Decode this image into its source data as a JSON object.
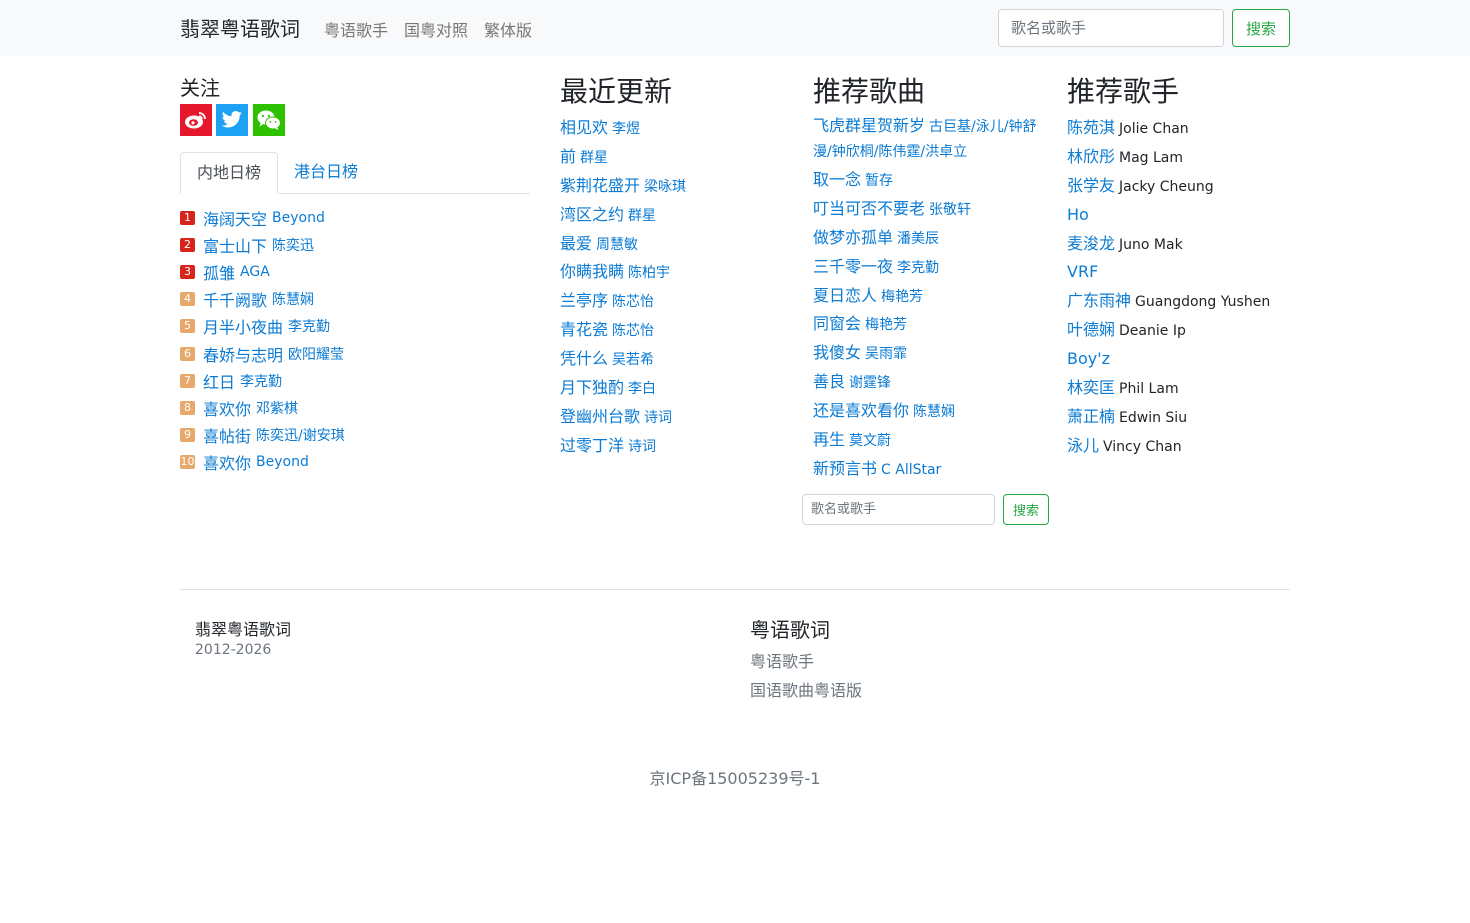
{
  "navbar": {
    "brand": "翡翠粤语歌词",
    "links": [
      "粤语歌手",
      "国粤对照",
      "繁体版"
    ],
    "search_placeholder": "歌名或歌手",
    "search_button": "搜索"
  },
  "follow": {
    "title": "关注",
    "icons": [
      "weibo-icon",
      "twitter-icon",
      "wechat-icon"
    ],
    "colors": {
      "weibo": "#e6162d",
      "twitter": "#1da1f2",
      "wechat": "#2dc100"
    }
  },
  "ranking": {
    "tabs": [
      "内地日榜",
      "港台日榜"
    ],
    "active_tab": "内地日榜",
    "items": [
      {
        "rank": "1",
        "song": "海阔天空",
        "artist": "Beyond"
      },
      {
        "rank": "2",
        "song": "富士山下",
        "artist": "陈奕迅"
      },
      {
        "rank": "3",
        "song": "孤雏",
        "artist": "AGA"
      },
      {
        "rank": "4",
        "song": "千千阙歌",
        "artist": "陈慧娴"
      },
      {
        "rank": "5",
        "song": "月半小夜曲",
        "artist": "李克勤"
      },
      {
        "rank": "6",
        "song": "春娇与志明",
        "artist": "欧阳耀莹"
      },
      {
        "rank": "7",
        "song": "红日",
        "artist": "李克勤"
      },
      {
        "rank": "8",
        "song": "喜欢你",
        "artist": "邓紫棋"
      },
      {
        "rank": "9",
        "song": "喜帖街",
        "artist": "陈奕迅/谢安琪"
      },
      {
        "rank": "10",
        "song": "喜欢你",
        "artist": "Beyond"
      }
    ]
  },
  "recent": {
    "title": "最近更新",
    "items": [
      {
        "song": "相见欢",
        "artist": "李煜"
      },
      {
        "song": "前",
        "artist": "群星"
      },
      {
        "song": "紫荆花盛开",
        "artist": "梁咏琪"
      },
      {
        "song": "湾区之约",
        "artist": "群星"
      },
      {
        "song": "最爱",
        "artist": "周慧敏"
      },
      {
        "song": "你瞒我瞒",
        "artist": "陈柏宇"
      },
      {
        "song": "兰亭序",
        "artist": "陈芯怡"
      },
      {
        "song": "青花瓷",
        "artist": "陈芯怡"
      },
      {
        "song": "凭什么",
        "artist": "吴若希"
      },
      {
        "song": "月下独酌",
        "artist": "李白"
      },
      {
        "song": "登幽州台歌",
        "artist": "诗词"
      },
      {
        "song": "过零丁洋",
        "artist": "诗词"
      }
    ]
  },
  "recommended_songs": {
    "title": "推荐歌曲",
    "items": [
      {
        "song": "飞虎群星贺新岁",
        "artist": "古巨基/泳儿/钟舒漫/钟欣桐/陈伟霆/洪卓立"
      },
      {
        "song": "取一念",
        "artist": "暂存"
      },
      {
        "song": "叮当可否不要老",
        "artist": "张敬轩"
      },
      {
        "song": "做梦亦孤单",
        "artist": "潘美辰"
      },
      {
        "song": "三千零一夜",
        "artist": "李克勤"
      },
      {
        "song": "夏日恋人",
        "artist": "梅艳芳"
      },
      {
        "song": "同窗会",
        "artist": "梅艳芳"
      },
      {
        "song": "我傻女",
        "artist": "吴雨霏"
      },
      {
        "song": "善良",
        "artist": "谢霆锋"
      },
      {
        "song": "还是喜欢看你",
        "artist": "陈慧娴"
      },
      {
        "song": "再生",
        "artist": "莫文蔚"
      },
      {
        "song": "新预言书",
        "artist": "C AllStar"
      }
    ]
  },
  "recommended_artists": {
    "title": "推荐歌手",
    "items": [
      {
        "name": "陈苑淇",
        "english": "Jolie Chan"
      },
      {
        "name": "林欣彤",
        "english": "Mag Lam"
      },
      {
        "name": "张学友",
        "english": "Jacky Cheung"
      },
      {
        "name": "Ho",
        "english": ""
      },
      {
        "name": "麦浚龙",
        "english": "Juno Mak"
      },
      {
        "name": "VRF",
        "english": ""
      },
      {
        "name": "广东雨神",
        "english": "Guangdong Yushen"
      },
      {
        "name": "叶德娴",
        "english": "Deanie Ip"
      },
      {
        "name": "Boy'z",
        "english": ""
      },
      {
        "name": "林奕匡",
        "english": "Phil Lam"
      },
      {
        "name": "萧正楠",
        "english": "Edwin Siu"
      },
      {
        "name": "泳儿",
        "english": "Vincy Chan"
      }
    ]
  },
  "mid_search": {
    "placeholder": "歌名或歌手",
    "button": "搜索"
  },
  "footer": {
    "brand": "翡翠粤语歌词",
    "years": "2012-2026",
    "title": "粤语歌词",
    "links": [
      "粤语歌手",
      "国语歌曲粤语版"
    ],
    "icp": "京ICP备15005239号-1"
  }
}
